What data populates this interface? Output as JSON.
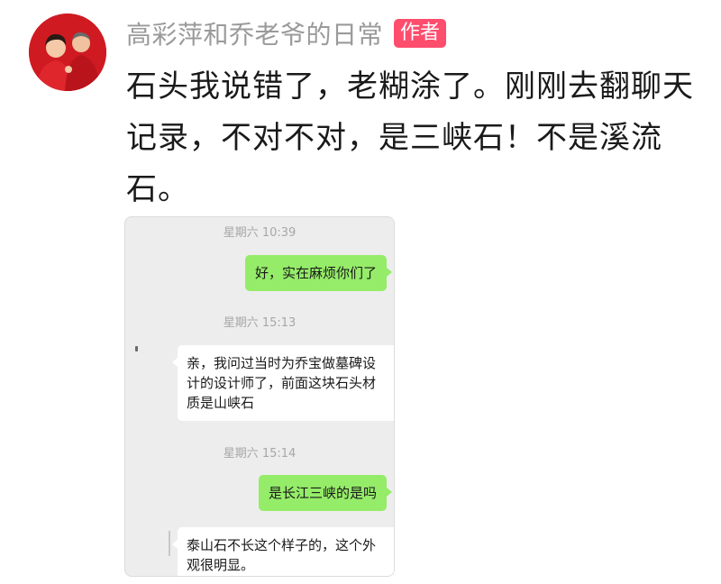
{
  "author": {
    "name": "高彩萍和乔老爷的日常",
    "badge": "作者"
  },
  "comment": {
    "text": "石头我说错了，老糊涂了。刚刚去翻聊天记录，不对不对，是三峡石！不是溪流石。"
  },
  "chat_screenshot": {
    "messages": [
      {
        "type": "time",
        "text": "星期六 10:39"
      },
      {
        "type": "outgoing",
        "text": "好，实在麻烦你们了"
      },
      {
        "type": "time",
        "text": "星期六 15:13"
      },
      {
        "type": "incoming",
        "text": "亲，我问过当时为乔宝做墓碑设计的设计师了，前面这块石头材质是山峡石"
      },
      {
        "type": "time",
        "text": "星期六 15:14"
      },
      {
        "type": "outgoing",
        "text": "是长江三峡的是吗"
      },
      {
        "type": "incoming",
        "text": "泰山石不长这个样子的，这个外观很明显。"
      }
    ]
  },
  "colors": {
    "author_name": "#9a9a9a",
    "badge_bg": "#ff4d6d",
    "outgoing_bubble": "#95ec69",
    "chat_bg": "#ededed"
  }
}
